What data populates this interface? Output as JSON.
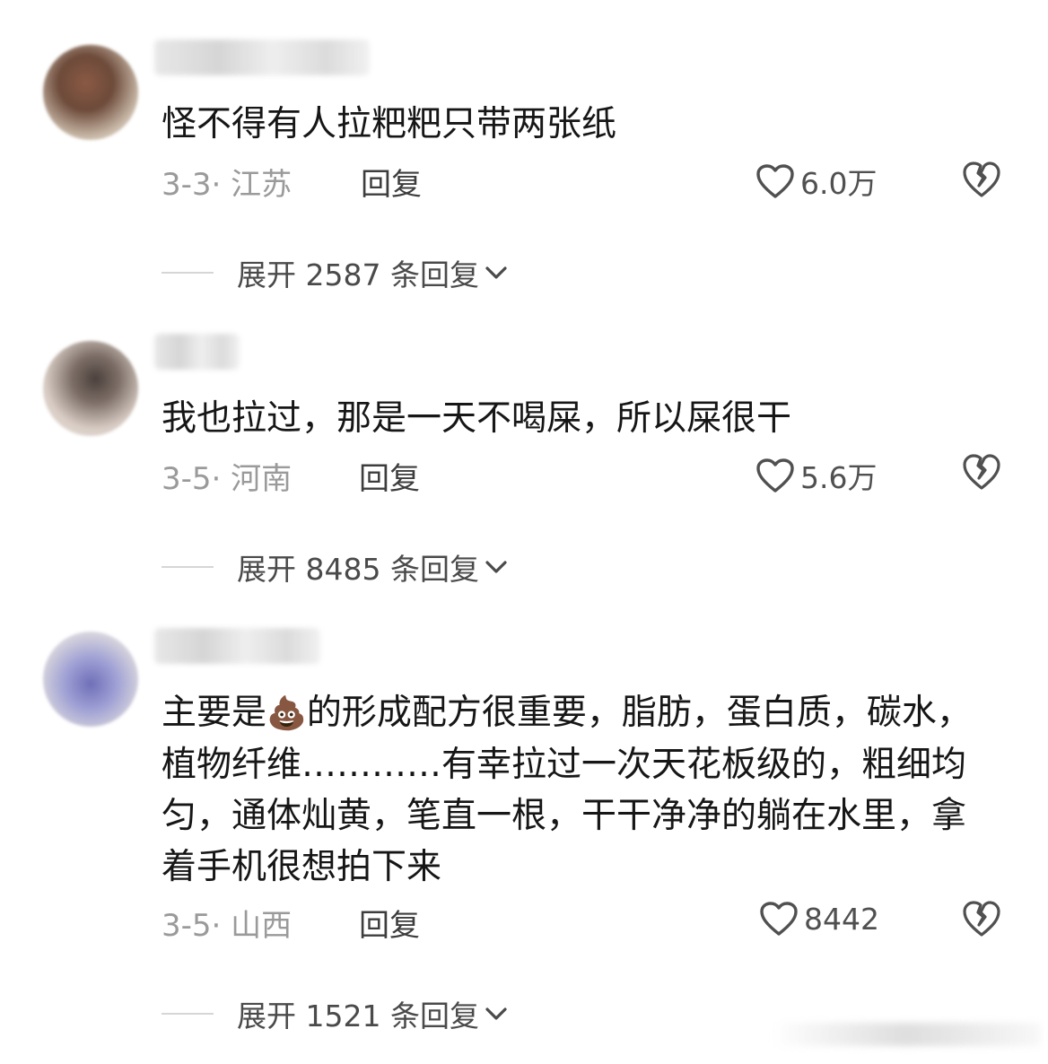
{
  "comments": [
    {
      "text": "怪不得有人拉粑粑只带两张纸",
      "meta": "3-3· 江苏",
      "reply_label": "回复",
      "likes": "6.0万",
      "expand_label": "展开 2587 条回复"
    },
    {
      "text": "我也拉过，那是一天不喝屎，所以屎很干",
      "meta": "3-5· 河南",
      "reply_label": "回复",
      "likes": "5.6万",
      "expand_label": "展开 8485 条回复"
    },
    {
      "text_before": "主要是",
      "emoji": "💩",
      "text_after": "的形成配方很重要，脂肪，蛋白质，碳水，植物纤维…………有幸拉过一次天花板级的，粗细均匀，通体灿黄，笔直一根，干干净净的躺在水里，拿着手机很想拍下来",
      "meta": "3-5· 山西",
      "reply_label": "回复",
      "likes": "8442",
      "expand_label": "展开 1521 条回复"
    }
  ],
  "icons": {
    "like": "heart-outline-icon",
    "dislike": "broken-heart-icon",
    "expand": "chevron-down-icon"
  },
  "colors": {
    "text": "#161616",
    "meta": "#9a9a9a",
    "icon": "#505050"
  }
}
